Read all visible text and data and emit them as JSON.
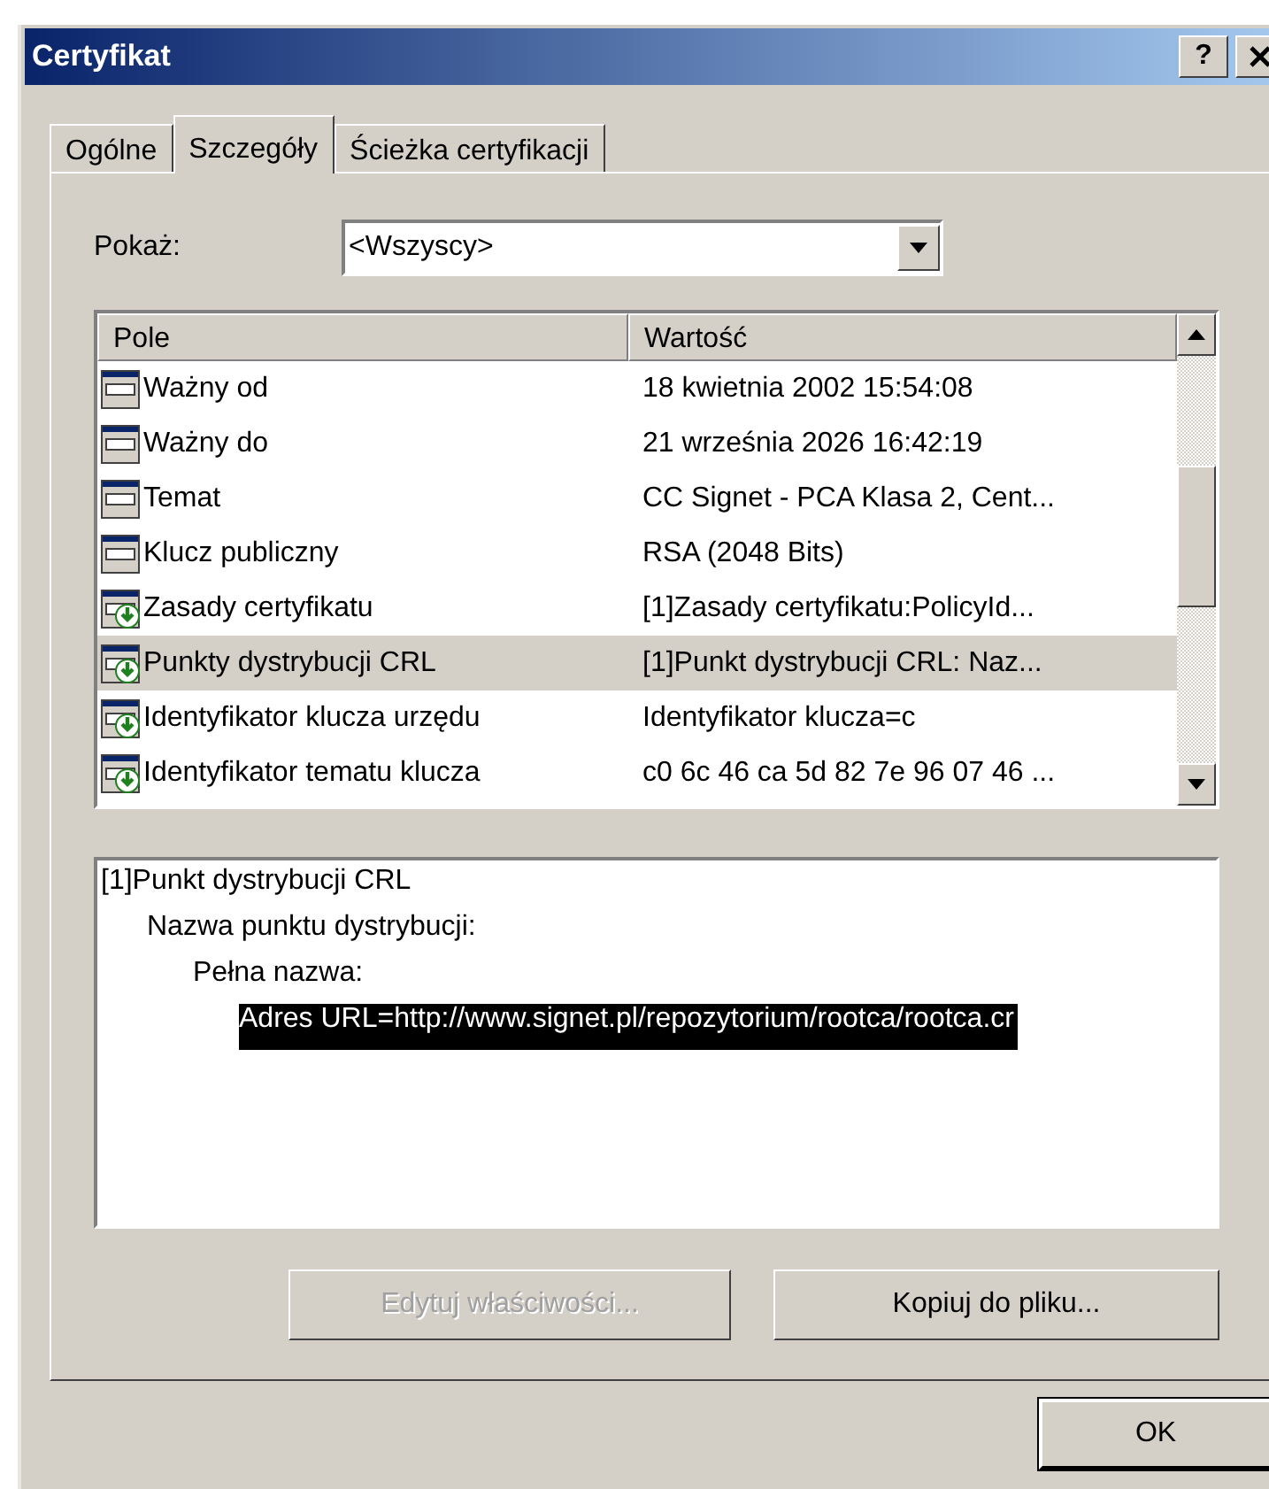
{
  "window": {
    "title": "Certyfikat",
    "help_button": "?"
  },
  "tabs": [
    {
      "label": "Ogólne",
      "selected": false
    },
    {
      "label": "Szczegóły",
      "selected": true
    },
    {
      "label": "Ścieżka certyfikacji",
      "selected": false
    }
  ],
  "show": {
    "label": "Pokaż:",
    "value": "<Wszyscy>"
  },
  "fields": {
    "columns": [
      "Pole",
      "Wartość"
    ],
    "rows": [
      {
        "kind": "basic",
        "field": "Ważny od",
        "value": "18 kwietnia 2002 15:54:08",
        "selected": false
      },
      {
        "kind": "basic",
        "field": "Ważny do",
        "value": "21 września 2026 16:42:19",
        "selected": false
      },
      {
        "kind": "basic",
        "field": "Temat",
        "value": "CC Signet - PCA Klasa 2, Cent...",
        "selected": false
      },
      {
        "kind": "basic",
        "field": "Klucz publiczny",
        "value": "RSA (2048 Bits)",
        "selected": false
      },
      {
        "kind": "extension",
        "field": "Zasady certyfikatu",
        "value": "[1]Zasady certyfikatu:PolicyId...",
        "selected": false
      },
      {
        "kind": "extension",
        "field": "Punkty dystrybucji CRL",
        "value": "[1]Punkt dystrybucji CRL: Naz...",
        "selected": true
      },
      {
        "kind": "extension",
        "field": "Identyfikator klucza urzędu",
        "value": "Identyfikator klucza=c",
        "selected": false
      },
      {
        "kind": "extension",
        "field": "Identyfikator tematu klucza",
        "value": "c0 6c 46 ca 5d 82 7e 96 07 46 ...",
        "selected": false
      }
    ]
  },
  "detail": [
    {
      "text": "[1]Punkt dystrybucji CRL",
      "selected": false,
      "children": [
        {
          "text": "Nazwa punktu dystrybucji:",
          "selected": false,
          "children": [
            {
              "text": "Pełna nazwa:",
              "selected": false,
              "children": [
                {
                  "text": "Adres URL=http://www.signet.pl/repozytorium/rootca/rootca.cr",
                  "selected": true
                }
              ]
            }
          ]
        }
      ]
    }
  ],
  "buttons": [
    {
      "label": "Edytuj właściwości...",
      "disabled": true
    },
    {
      "label": "Kopiuj do pliku...",
      "disabled": false
    }
  ],
  "ok_button": "OK"
}
